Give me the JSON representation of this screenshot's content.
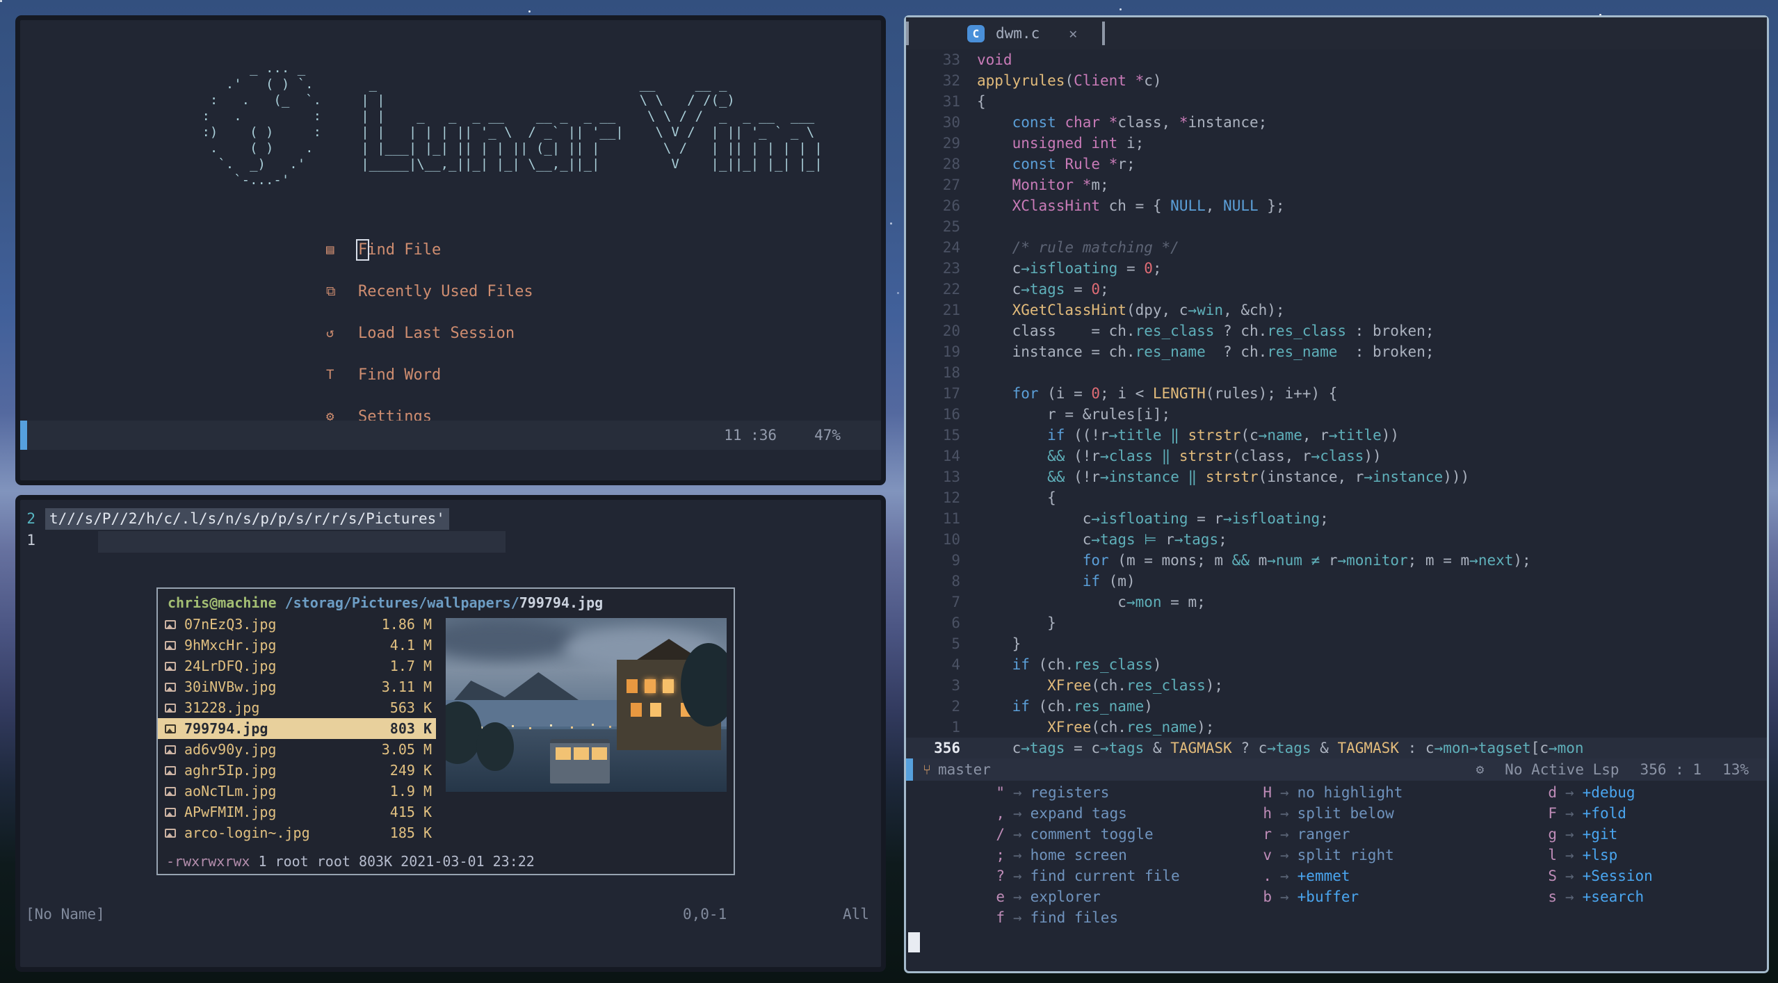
{
  "colors": {
    "accent_blue": "#56a0dd",
    "window_bg": "#212633",
    "focus_border": "#a4bacc",
    "salmon": "#cf8d70",
    "logo_cyan": "#a9ced8",
    "tan_file": "#e2c181",
    "selection_tan": "#e8d09c",
    "branch_orange": "#d19a66",
    "group_blue": "#4aa6f0"
  },
  "dashboard": {
    "logo": "       _ ... _\n    .'   ( ) `.       _                                 __     __ _\n  :   .   (_  `.     | |                                \\ \\   / /(_)\n :   .         :     | |    _   _  _ __    __ _  _ __    \\ \\ / /  _  _ __  ___\n :)    ( )     :     | |   | | | || '_ \\  / _` || '__|    \\ V /  | || '_ ` _ \\\n  .    ( )    .      | |___| |_| || | | || (_| || |        \\ /   | || | | | | |\n   `.  _)   .'       |_____|\\__,_||_| |_| \\__,_||_|         V    |_||_| |_| |_|\n     `-...-'",
    "menu": [
      {
        "icon": "file-icon",
        "glyph": "▤",
        "label": "Find File",
        "cursor": true
      },
      {
        "icon": "recent-files-icon",
        "glyph": "⧉",
        "label": "Recently Used Files"
      },
      {
        "icon": "session-icon",
        "glyph": "↺",
        "label": "Load Last Session"
      },
      {
        "icon": "find-word-icon",
        "glyph": "T",
        "label": "Find Word"
      },
      {
        "icon": "settings-gear-icon",
        "glyph": "⚙",
        "label": "Settings"
      }
    ],
    "statusline": {
      "time": "11 :36",
      "progress": "47%"
    }
  },
  "scratch": {
    "line2_num": "2",
    "line2_text": "t///s/P//2/h/c/.l/s/n/s/p/p/s/r/r/s/Pictures'",
    "line1_num": "1",
    "statusline": {
      "name": "[No Name]",
      "position": "0,0-1",
      "scroll": "All"
    }
  },
  "ranger": {
    "user": "chris@machine",
    "path": " /storag/Pictures/wallpapers/",
    "file": "799794.jpg",
    "files": [
      {
        "name": "07nEzQ3.jpg",
        "size": "1.86 M"
      },
      {
        "name": "9hMxcHr.jpg",
        "size": "4.1 M"
      },
      {
        "name": "24LrDFQ.jpg",
        "size": "1.7 M"
      },
      {
        "name": "30iNVBw.jpg",
        "size": "3.11 M"
      },
      {
        "name": "31228.jpg",
        "size": "563 K"
      },
      {
        "name": "799794.jpg",
        "size": "803 K",
        "selected": true
      },
      {
        "name": "ad6v90y.jpg",
        "size": "3.05 M"
      },
      {
        "name": "aghr5Ip.jpg",
        "size": "249 K"
      },
      {
        "name": "aoNcTLm.jpg",
        "size": "1.9 M"
      },
      {
        "name": "APwFMIM.jpg",
        "size": "415 K"
      },
      {
        "name": "arco-login~.jpg",
        "size": "185 K"
      }
    ],
    "footer_perms": "-rwxrwxrwx",
    "footer_rest": " 1 root root 803K 2021-03-01 23:22"
  },
  "editor": {
    "tab": {
      "icon": "c-language-icon",
      "icon_letter": "C",
      "label": "dwm.c",
      "close": "✕"
    },
    "lines": [
      {
        "n": "33",
        "tk": [
          [
            "void",
            "k"
          ]
        ]
      },
      {
        "n": "32",
        "tk": [
          [
            "applyrules",
            "f"
          ],
          [
            "(",
            "t"
          ],
          [
            "Client",
            "k"
          ],
          [
            " ",
            "t"
          ],
          [
            "*",
            "k"
          ],
          [
            "c)",
            "t"
          ]
        ]
      },
      {
        "n": "31",
        "tk": [
          [
            "{",
            "t"
          ]
        ]
      },
      {
        "n": "30",
        "tk": [
          [
            "    ",
            "t"
          ],
          [
            "const",
            "b"
          ],
          [
            " ",
            "t"
          ],
          [
            "char",
            "k"
          ],
          [
            " ",
            "t"
          ],
          [
            "*",
            "k"
          ],
          [
            "class, ",
            "t"
          ],
          [
            "*",
            "k"
          ],
          [
            "instance;",
            "t"
          ]
        ]
      },
      {
        "n": "29",
        "tk": [
          [
            "    ",
            "t"
          ],
          [
            "unsigned",
            "k"
          ],
          [
            " ",
            "t"
          ],
          [
            "int",
            "k"
          ],
          [
            " i;",
            "t"
          ]
        ]
      },
      {
        "n": "28",
        "tk": [
          [
            "    ",
            "t"
          ],
          [
            "const",
            "b"
          ],
          [
            " ",
            "t"
          ],
          [
            "Rule",
            "k"
          ],
          [
            " ",
            "t"
          ],
          [
            "*",
            "k"
          ],
          [
            "r;",
            "t"
          ]
        ]
      },
      {
        "n": "27",
        "tk": [
          [
            "    ",
            "t"
          ],
          [
            "Monitor",
            "k"
          ],
          [
            " ",
            "t"
          ],
          [
            "*",
            "k"
          ],
          [
            "m;",
            "t"
          ]
        ]
      },
      {
        "n": "26",
        "tk": [
          [
            "    ",
            "t"
          ],
          [
            "XClassHint",
            "k"
          ],
          [
            " ch = { ",
            "t"
          ],
          [
            "NULL",
            "b"
          ],
          [
            ", ",
            "t"
          ],
          [
            "NULL",
            "b"
          ],
          [
            " };",
            "t"
          ]
        ]
      },
      {
        "n": "25",
        "tk": []
      },
      {
        "n": "24",
        "tk": [
          [
            "    ",
            "t"
          ],
          [
            "/* rule matching */",
            "c"
          ]
        ]
      },
      {
        "n": "23",
        "tk": [
          [
            "    c",
            "t"
          ],
          [
            "→",
            "p"
          ],
          [
            "isfloating",
            "p"
          ],
          [
            " = ",
            "t"
          ],
          [
            "0",
            "n"
          ],
          [
            ";",
            "t"
          ]
        ]
      },
      {
        "n": "22",
        "tk": [
          [
            "    c",
            "t"
          ],
          [
            "→",
            "p"
          ],
          [
            "tags",
            "p"
          ],
          [
            " = ",
            "t"
          ],
          [
            "0",
            "n"
          ],
          [
            ";",
            "t"
          ]
        ]
      },
      {
        "n": "21",
        "tk": [
          [
            "    ",
            "t"
          ],
          [
            "XGetClassHint",
            "f"
          ],
          [
            "(dpy, c",
            "t"
          ],
          [
            "→",
            "p"
          ],
          [
            "win",
            "p"
          ],
          [
            ", &ch);",
            "t"
          ]
        ]
      },
      {
        "n": "20",
        "tk": [
          [
            "    class    = ch.",
            "t"
          ],
          [
            "res_class",
            "p"
          ],
          [
            " ? ch.",
            "t"
          ],
          [
            "res_class",
            "p"
          ],
          [
            " : broken;",
            "t"
          ]
        ]
      },
      {
        "n": "19",
        "tk": [
          [
            "    instance = ch.",
            "t"
          ],
          [
            "res_name",
            "p"
          ],
          [
            "  ? ch.",
            "t"
          ],
          [
            "res_name",
            "p"
          ],
          [
            "  : broken;",
            "t"
          ]
        ]
      },
      {
        "n": "18",
        "tk": []
      },
      {
        "n": "17",
        "tk": [
          [
            "    ",
            "t"
          ],
          [
            "for",
            "b"
          ],
          [
            " (i = ",
            "t"
          ],
          [
            "0",
            "n"
          ],
          [
            "; i < ",
            "t"
          ],
          [
            "LENGTH",
            "f"
          ],
          [
            "(rules); i++) {",
            "t"
          ]
        ]
      },
      {
        "n": "16",
        "tk": [
          [
            "        r = &rules[i];",
            "t"
          ]
        ]
      },
      {
        "n": "15",
        "tk": [
          [
            "        ",
            "t"
          ],
          [
            "if",
            "b"
          ],
          [
            " ((!r",
            "t"
          ],
          [
            "→",
            "p"
          ],
          [
            "title",
            "p"
          ],
          [
            " ",
            "t"
          ],
          [
            "‖",
            "p"
          ],
          [
            " ",
            "t"
          ],
          [
            "strstr",
            "f"
          ],
          [
            "(c",
            "t"
          ],
          [
            "→",
            "p"
          ],
          [
            "name",
            "p"
          ],
          [
            ", r",
            "t"
          ],
          [
            "→",
            "p"
          ],
          [
            "title",
            "p"
          ],
          [
            "))",
            "t"
          ]
        ]
      },
      {
        "n": "14",
        "tk": [
          [
            "        ",
            "t"
          ],
          [
            "&&",
            "p"
          ],
          [
            " (!r",
            "t"
          ],
          [
            "→",
            "p"
          ],
          [
            "class",
            "p"
          ],
          [
            " ",
            "t"
          ],
          [
            "‖",
            "p"
          ],
          [
            " ",
            "t"
          ],
          [
            "strstr",
            "f"
          ],
          [
            "(class, r",
            "t"
          ],
          [
            "→",
            "p"
          ],
          [
            "class",
            "p"
          ],
          [
            "))",
            "t"
          ]
        ]
      },
      {
        "n": "13",
        "tk": [
          [
            "        ",
            "t"
          ],
          [
            "&&",
            "p"
          ],
          [
            " (!r",
            "t"
          ],
          [
            "→",
            "p"
          ],
          [
            "instance",
            "p"
          ],
          [
            " ",
            "t"
          ],
          [
            "‖",
            "p"
          ],
          [
            " ",
            "t"
          ],
          [
            "strstr",
            "f"
          ],
          [
            "(instance, r",
            "t"
          ],
          [
            "→",
            "p"
          ],
          [
            "instance",
            "p"
          ],
          [
            ")))",
            "t"
          ]
        ]
      },
      {
        "n": "12",
        "tk": [
          [
            "        {",
            "t"
          ]
        ]
      },
      {
        "n": "11",
        "tk": [
          [
            "            c",
            "t"
          ],
          [
            "→",
            "p"
          ],
          [
            "isfloating",
            "p"
          ],
          [
            " = r",
            "t"
          ],
          [
            "→",
            "p"
          ],
          [
            "isfloating",
            "p"
          ],
          [
            ";",
            "t"
          ]
        ]
      },
      {
        "n": "10",
        "tk": [
          [
            "            c",
            "t"
          ],
          [
            "→",
            "p"
          ],
          [
            "tags",
            "p"
          ],
          [
            " ",
            "t"
          ],
          [
            "⊨",
            "p"
          ],
          [
            " r",
            "t"
          ],
          [
            "→",
            "p"
          ],
          [
            "tags",
            "p"
          ],
          [
            ";",
            "t"
          ]
        ]
      },
      {
        "n": "9",
        "tk": [
          [
            "            ",
            "t"
          ],
          [
            "for",
            "b"
          ],
          [
            " (m = mons; m ",
            "t"
          ],
          [
            "&&",
            "p"
          ],
          [
            " m",
            "t"
          ],
          [
            "→",
            "p"
          ],
          [
            "num",
            "p"
          ],
          [
            " ",
            "t"
          ],
          [
            "≠",
            "p"
          ],
          [
            " r",
            "t"
          ],
          [
            "→",
            "p"
          ],
          [
            "monitor",
            "p"
          ],
          [
            "; m = m",
            "t"
          ],
          [
            "→",
            "p"
          ],
          [
            "next",
            "p"
          ],
          [
            ");",
            "t"
          ]
        ]
      },
      {
        "n": "8",
        "tk": [
          [
            "            ",
            "t"
          ],
          [
            "if",
            "b"
          ],
          [
            " (m)",
            "t"
          ]
        ]
      },
      {
        "n": "7",
        "tk": [
          [
            "                c",
            "t"
          ],
          [
            "→",
            "p"
          ],
          [
            "mon",
            "p"
          ],
          [
            " = m;",
            "t"
          ]
        ]
      },
      {
        "n": "6",
        "tk": [
          [
            "        }",
            "t"
          ]
        ]
      },
      {
        "n": "5",
        "tk": [
          [
            "    }",
            "t"
          ]
        ]
      },
      {
        "n": "4",
        "tk": [
          [
            "    ",
            "t"
          ],
          [
            "if",
            "b"
          ],
          [
            " (ch.",
            "t"
          ],
          [
            "res_class",
            "p"
          ],
          [
            ")",
            "t"
          ]
        ]
      },
      {
        "n": "3",
        "tk": [
          [
            "        ",
            "t"
          ],
          [
            "XFree",
            "f"
          ],
          [
            "(ch.",
            "t"
          ],
          [
            "res_class",
            "p"
          ],
          [
            ");",
            "t"
          ]
        ]
      },
      {
        "n": "2",
        "tk": [
          [
            "    ",
            "t"
          ],
          [
            "if",
            "b"
          ],
          [
            " (ch.",
            "t"
          ],
          [
            "res_name",
            "p"
          ],
          [
            ")",
            "t"
          ]
        ]
      },
      {
        "n": "1",
        "tk": [
          [
            "        ",
            "t"
          ],
          [
            "XFree",
            "f"
          ],
          [
            "(ch.",
            "t"
          ],
          [
            "res_name",
            "p"
          ],
          [
            ");",
            "t"
          ]
        ]
      },
      {
        "n": "356",
        "cur": true,
        "tk": [
          [
            "    c",
            "t"
          ],
          [
            "→",
            "p"
          ],
          [
            "tags",
            "p"
          ],
          [
            " = c",
            "t"
          ],
          [
            "→",
            "p"
          ],
          [
            "tags",
            "p"
          ],
          [
            " & ",
            "t"
          ],
          [
            "TAGMASK",
            "f"
          ],
          [
            " ? c",
            "t"
          ],
          [
            "→",
            "p"
          ],
          [
            "tags",
            "p"
          ],
          [
            " & ",
            "t"
          ],
          [
            "TAGMASK",
            "f"
          ],
          [
            " : c",
            "t"
          ],
          [
            "→",
            "p"
          ],
          [
            "mon",
            "p"
          ],
          [
            "→",
            "p"
          ],
          [
            "tagset",
            "p"
          ],
          [
            "[c",
            "t"
          ],
          [
            "→",
            "p"
          ],
          [
            "mon",
            "p"
          ]
        ]
      }
    ],
    "statusline": {
      "branch": "master",
      "lsp": "No Active Lsp",
      "position": "356 : 1",
      "progress": "13%"
    },
    "whichkey": [
      [
        {
          "k": "\"",
          "d": "registers"
        },
        {
          "k": ",",
          "d": "expand tags"
        },
        {
          "k": "/",
          "d": "comment toggle"
        },
        {
          "k": ";",
          "d": "home screen"
        },
        {
          "k": "?",
          "d": "find current file"
        },
        {
          "k": "e",
          "d": "explorer"
        },
        {
          "k": "f",
          "d": "find files"
        }
      ],
      [
        {
          "k": "H",
          "d": "no highlight"
        },
        {
          "k": "h",
          "d": "split below"
        },
        {
          "k": "r",
          "d": "ranger"
        },
        {
          "k": "v",
          "d": "split right"
        },
        {
          "k": ".",
          "d": "+emmet"
        },
        {
          "k": "b",
          "d": "+buffer"
        }
      ],
      [
        {
          "k": "d",
          "d": "+debug"
        },
        {
          "k": "F",
          "d": "+fold"
        },
        {
          "k": "g",
          "d": "+git"
        },
        {
          "k": "l",
          "d": "+lsp"
        },
        {
          "k": "S",
          "d": "+Session"
        },
        {
          "k": "s",
          "d": "+search"
        }
      ]
    ]
  }
}
